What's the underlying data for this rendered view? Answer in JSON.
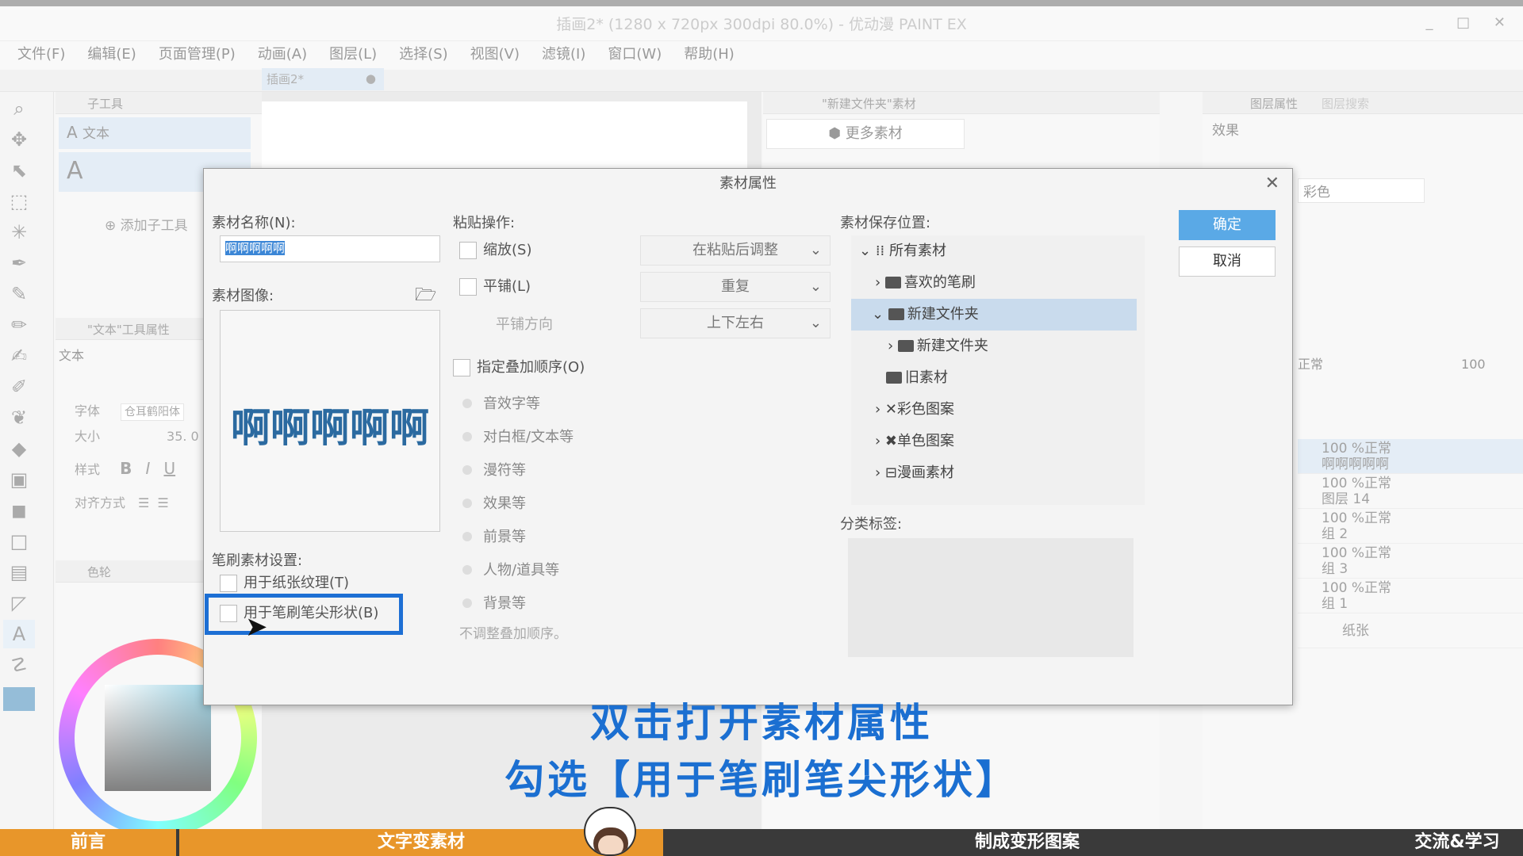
{
  "window": {
    "title": "插画2* (1280 x 720px 300dpi 80.0%) - 优动漫 PAINT EX"
  },
  "menu": [
    "文件(F)",
    "编辑(E)",
    "页面管理(P)",
    "动画(A)",
    "图层(L)",
    "选择(S)",
    "视图(V)",
    "滤镜(I)",
    "窗口(W)",
    "帮助(H)"
  ],
  "doc_tab": {
    "label": "插画2*",
    "dot": "●"
  },
  "subtool": {
    "tab": "子工具",
    "item_selected": "文本",
    "add_label": "添加子工具"
  },
  "tool_props": {
    "tab": "\"文本\"工具属性",
    "title": "文本",
    "font_label": "字体",
    "font_value": "仓耳鹤阳体",
    "size_label": "大小",
    "size_value": "35. 0",
    "style_label": "样式",
    "bold": "B",
    "italic": "I",
    "underline": "U",
    "align_label": "对齐方式"
  },
  "color_panel": {
    "tab": "色轮"
  },
  "material_panel": {
    "tab": "\"新建文件夹\"素材",
    "more_label": "更多素材"
  },
  "layer_panel": {
    "tab": "图层属性",
    "tab2": "图层搜索",
    "effect": "效果",
    "color_mode": "彩色",
    "blend": "正常",
    "opacity": "100",
    "layers": [
      {
        "mode": "100 %正常",
        "name": "啊啊啊啊啊"
      },
      {
        "mode": "100 %正常",
        "name": "图层 14"
      },
      {
        "mode": "100 %正常",
        "name": "组 2"
      },
      {
        "mode": "100 %正常",
        "name": "组 3"
      },
      {
        "mode": "100 %正常",
        "name": "组 1"
      },
      {
        "mode": "",
        "name": "纸张"
      }
    ]
  },
  "dialog": {
    "title": "素材属性",
    "name_label": "素材名称(N):",
    "name_value": "啊啊啊啊啊",
    "image_label": "素材图像:",
    "preview_text": "啊啊啊啊啊",
    "brush_label": "笔刷素材设置:",
    "paper_texture": "用于纸张纹理(T)",
    "brush_tip": "用于笔刷笔尖形状(B)",
    "paste_label": "粘贴操作:",
    "scale": "缩放(S)",
    "scale_dd": "在粘贴后调整",
    "tile": "平铺(L)",
    "tile_dd": "重复",
    "tile_dir_label": "平铺方向",
    "tile_dir_dd": "上下左右",
    "order_label": "指定叠加顺序(O)",
    "orders": [
      "音效字等",
      "对白框/文本等",
      "漫符等",
      "效果等",
      "前景等",
      "人物/道具等",
      "背景等"
    ],
    "no_order": "不调整叠加顺序。",
    "location_label": "素材保存位置:",
    "tree": [
      "所有素材",
      "喜欢的笔刷",
      "新建文件夹",
      "新建文件夹",
      "旧素材",
      "彩色图案",
      "单色图案",
      "漫画素材"
    ],
    "tag_label": "分类标签:",
    "ok": "确定",
    "cancel": "取消"
  },
  "captions": {
    "line1": "双击打开素材属性",
    "line2": "勾选【用于笔刷笔尖形状】"
  },
  "chapters": [
    "前言",
    "文字变素材",
    "制成变形图案",
    "交流&学习"
  ],
  "colors": {
    "accent": "#1b6fd1",
    "highlight_box": "#1d6fd4",
    "ok_button": "#5aa9e6",
    "chapter_active": "#e8962a"
  }
}
